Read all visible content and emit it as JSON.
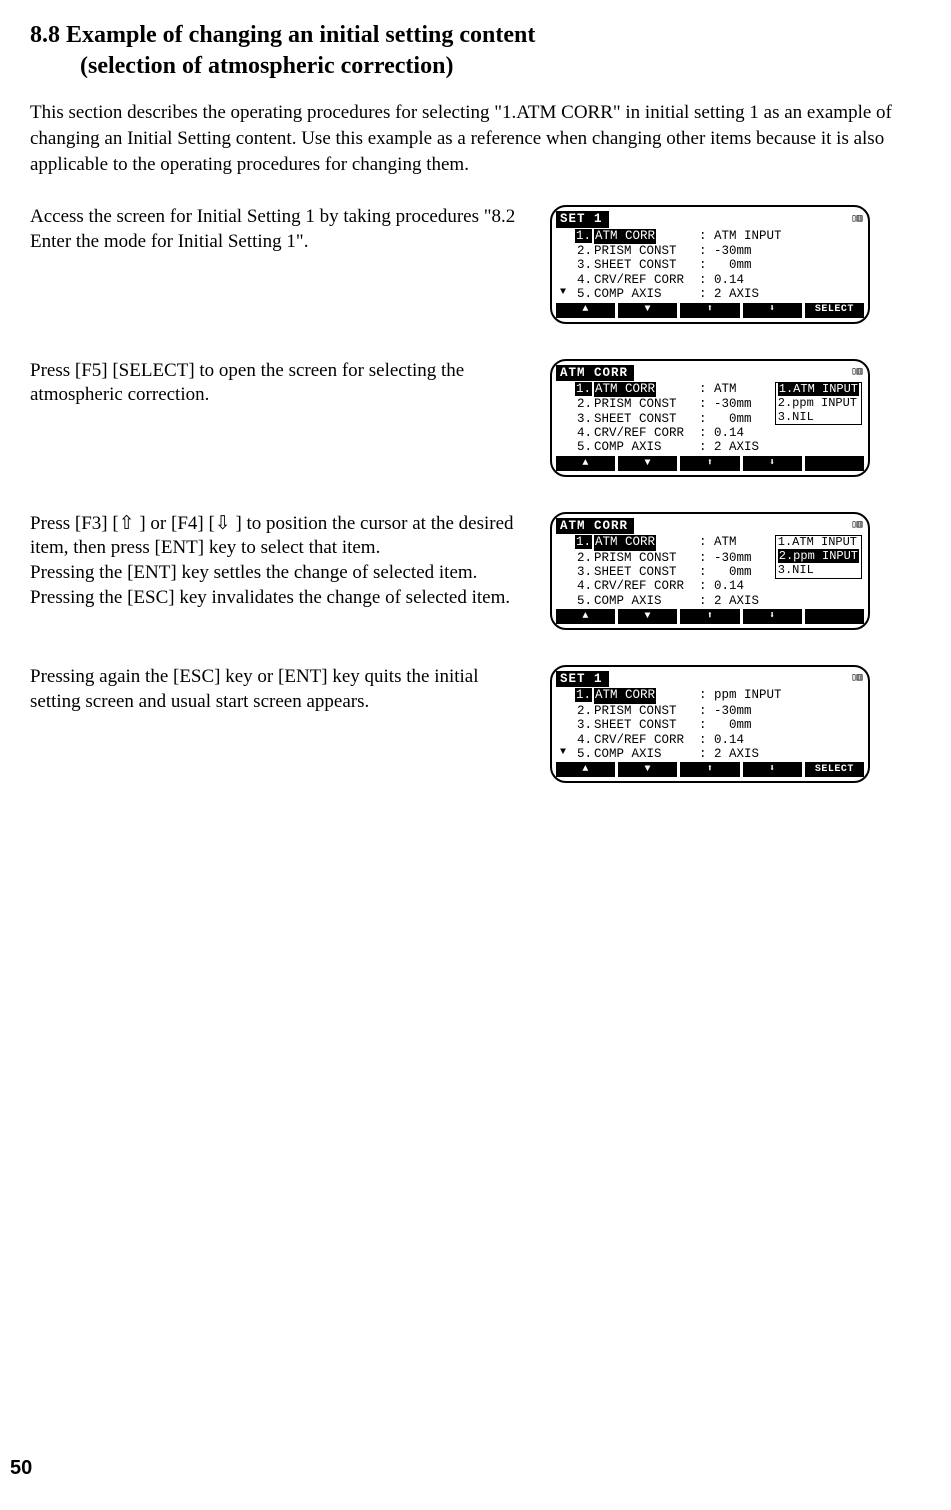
{
  "heading": {
    "line1": "8.8 Example of changing an initial setting content",
    "line2": "(selection of atmospheric correction)"
  },
  "intro": "This section describes the operating procedures for selecting \"1.ATM CORR\" in initial setting 1 as an example of changing an Initial Setting content. Use this example as a reference when changing other items because it is also applicable to the operating procedures for changing them.",
  "steps": {
    "s1": {
      "text": "Access the screen for Initial Setting 1 by taking procedures \"8.2 Enter the mode for Initial Setting 1\".",
      "lcd": {
        "title": "SET 1",
        "rows": [
          {
            "num": "1.",
            "label": "ATM CORR",
            "val": ": ATM INPUT",
            "hl": true
          },
          {
            "num": "2.",
            "label": "PRISM CONST",
            "val": ": -30mm"
          },
          {
            "num": "3.",
            "label": "SHEET CONST",
            "val": ":   0mm"
          },
          {
            "num": "4.",
            "label": "CRV/REF CORR",
            "val": ": 0.14"
          },
          {
            "num": "5.",
            "label": "COMP AXIS",
            "val": ": 2 AXIS",
            "marker": "▼"
          }
        ],
        "foot": [
          "▲",
          "▼",
          "⬆",
          "⬇",
          "SELECT"
        ]
      }
    },
    "s2": {
      "text": "Press [F5] [SELECT] to open the screen for selecting the atmospheric correction.",
      "lcd": {
        "title": "ATM CORR",
        "rows": [
          {
            "num": "1.",
            "label": "ATM CORR",
            "val": ": ATM",
            "hl": true
          },
          {
            "num": "2.",
            "label": "PRISM CONST",
            "val": ": -30mm"
          },
          {
            "num": "3.",
            "label": "SHEET CONST",
            "val": ":   0mm"
          },
          {
            "num": "4.",
            "label": "CRV/REF CORR",
            "val": ": 0.14"
          },
          {
            "num": "5.",
            "label": "COMP AXIS",
            "val": ": 2 AXIS"
          }
        ],
        "popup": [
          {
            "t": "1.ATM INPUT",
            "hl": true
          },
          {
            "t": "2.ppm INPUT"
          },
          {
            "t": "3.NIL"
          }
        ],
        "foot": [
          "▲",
          "▼",
          "⬆",
          "⬇",
          ""
        ]
      }
    },
    "s3": {
      "p1": "Press [F3] [⇧  ] or [F4] [⇩   ] to position the cursor at the desired item, then press [ENT] key to select that item.",
      "p2": "Pressing the [ENT] key settles the change of selected item. Pressing the [ESC] key invalidates the change of selected item.",
      "lcd": {
        "title": "ATM CORR",
        "rows": [
          {
            "num": "1.",
            "label": "ATM CORR",
            "val": ": ATM",
            "hl": true
          },
          {
            "num": "2.",
            "label": "PRISM CONST",
            "val": ": -30mm"
          },
          {
            "num": "3.",
            "label": "SHEET CONST",
            "val": ":   0mm"
          },
          {
            "num": "4.",
            "label": "CRV/REF CORR",
            "val": ": 0.14"
          },
          {
            "num": "5.",
            "label": "COMP AXIS",
            "val": ": 2 AXIS"
          }
        ],
        "popup": [
          {
            "t": "1.ATM INPUT"
          },
          {
            "t": "2.ppm INPUT",
            "hl": true
          },
          {
            "t": "3.NIL"
          }
        ],
        "foot": [
          "▲",
          "▼",
          "⬆",
          "⬇",
          ""
        ]
      }
    },
    "s4": {
      "text": "Pressing again the [ESC] key or [ENT] key quits the initial setting screen and usual start screen appears.",
      "lcd": {
        "title": "SET 1",
        "rows": [
          {
            "num": "1.",
            "label": "ATM CORR",
            "val": ": ppm INPUT",
            "hl": true
          },
          {
            "num": "2.",
            "label": "PRISM CONST",
            "val": ": -30mm"
          },
          {
            "num": "3.",
            "label": "SHEET CONST",
            "val": ":   0mm"
          },
          {
            "num": "4.",
            "label": "CRV/REF CORR",
            "val": ": 0.14"
          },
          {
            "num": "5.",
            "label": "COMP AXIS",
            "val": ": 2 AXIS",
            "marker": "▼"
          }
        ],
        "foot": [
          "▲",
          "▼",
          "⬆",
          "⬇",
          "SELECT"
        ]
      }
    }
  },
  "page_number": "50",
  "battery_glyph": "▯▥"
}
